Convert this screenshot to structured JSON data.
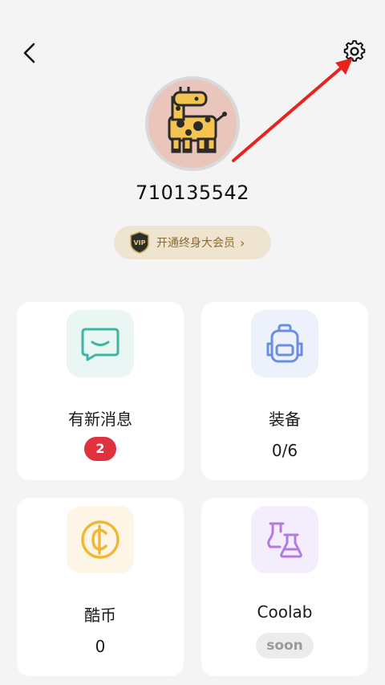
{
  "profile": {
    "username": "710135542"
  },
  "vip": {
    "badge_text": "VIP",
    "label": "开通终身大会员",
    "chevron": "›"
  },
  "cards": {
    "messages": {
      "title": "有新消息",
      "badge": "2",
      "icon": "message-icon"
    },
    "equipment": {
      "title": "装备",
      "value": "0/6",
      "icon": "backpack-icon"
    },
    "coins": {
      "title": "酷币",
      "value": "0",
      "icon": "coin-icon"
    },
    "coolab": {
      "title": "Coolab",
      "badge": "soon",
      "icon": "flask-icon"
    }
  },
  "colors": {
    "background": "#f4f4f4",
    "card": "#ffffff",
    "accent_red": "#e0323e",
    "vip_gold": "#8b6a33",
    "message_teal": "#3fb6a3",
    "backpack_blue": "#6b8fe0",
    "coin_yellow": "#f2b534",
    "flask_purple": "#b27be3",
    "annotation_arrow": "#e8231f"
  }
}
